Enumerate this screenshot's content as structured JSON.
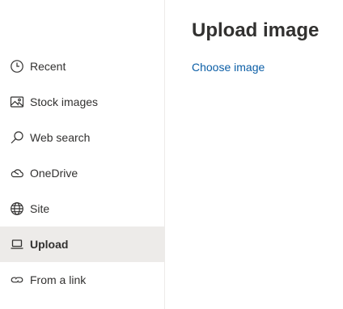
{
  "sidebar": {
    "items": [
      {
        "label": "Recent",
        "icon": "clock-icon"
      },
      {
        "label": "Stock images",
        "icon": "image-icon"
      },
      {
        "label": "Web search",
        "icon": "search-icon"
      },
      {
        "label": "OneDrive",
        "icon": "cloud-icon"
      },
      {
        "label": "Site",
        "icon": "globe-icon"
      },
      {
        "label": "Upload",
        "icon": "laptop-icon",
        "selected": true
      },
      {
        "label": "From a link",
        "icon": "link-icon"
      }
    ]
  },
  "main": {
    "title": "Upload image",
    "choose_label": "Choose image"
  },
  "colors": {
    "accent_link": "#0b5ea6",
    "selected_bg": "#edebe9",
    "text": "#323130"
  }
}
